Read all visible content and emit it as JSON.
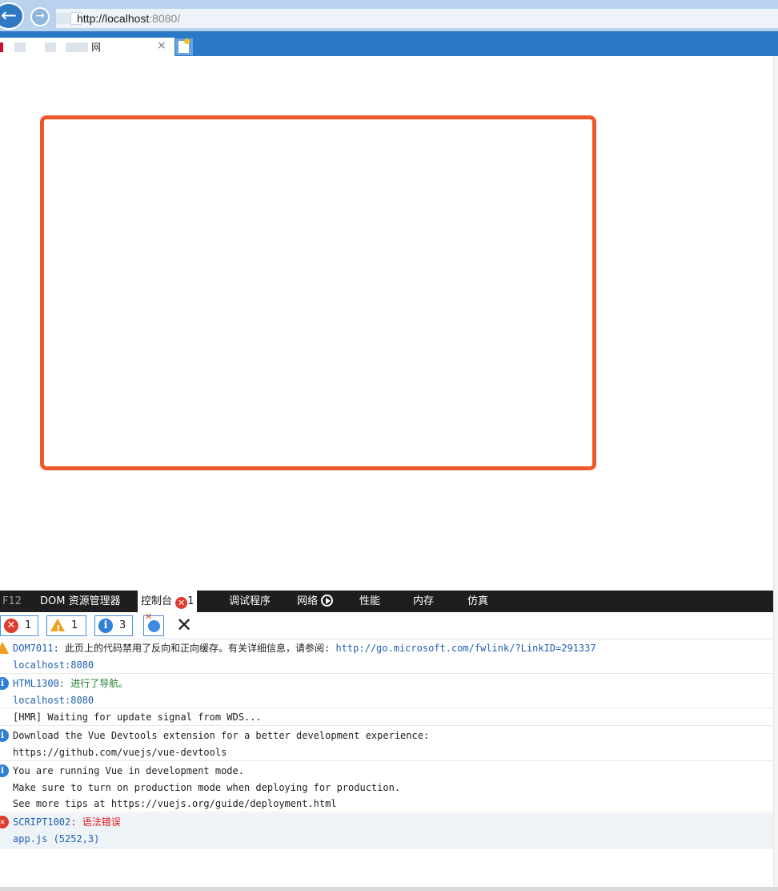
{
  "browser": {
    "url_host": "http://localhost",
    "url_port": ":8080/",
    "tab_title": "网",
    "tab_close": "×"
  },
  "devtools": {
    "tabs": {
      "f12": "F12",
      "dom": "DOM 资源管理器",
      "console": "控制台",
      "console_badge": "1",
      "debugger": "调试程序",
      "network": "网络",
      "performance": "性能",
      "memory": "内存",
      "emulation": "仿真"
    },
    "filters": {
      "errors": "1",
      "warnings": "1",
      "info": "3"
    },
    "close": "✕"
  },
  "console": {
    "messages": [
      {
        "level": "warning",
        "code": "DOM7011",
        "text": ": 此页上的代码禁用了反向和正向缓存。有关详细信息，请参阅: ",
        "link": "http://go.microsoft.com/fwlink/?LinkID=291337",
        "source": "localhost:8080"
      },
      {
        "level": "info",
        "code": "HTML1300",
        "text": ": 进行了导航。",
        "source": "localhost:8080"
      },
      {
        "level": "log",
        "text": "[HMR] Waiting for update signal from WDS..."
      },
      {
        "level": "info",
        "line1": "Download the Vue Devtools extension for a better development experience:",
        "line2": "https://github.com/vuejs/vue-devtools"
      },
      {
        "level": "info",
        "line1": "You are running Vue in development mode.",
        "line2": "Make sure to turn on production mode when deploying for production.",
        "line3": "See more tips at https://vuejs.org/guide/deployment.html"
      },
      {
        "level": "error",
        "code": "SCRIPT1002",
        "text": ": 语法错误",
        "source": "app.js (5252,3)"
      }
    ]
  },
  "colors": {
    "highlight_border": "#ec5a2c",
    "error": "#e03b2f",
    "warning": "#f0a020",
    "info": "#2f7fd6"
  }
}
